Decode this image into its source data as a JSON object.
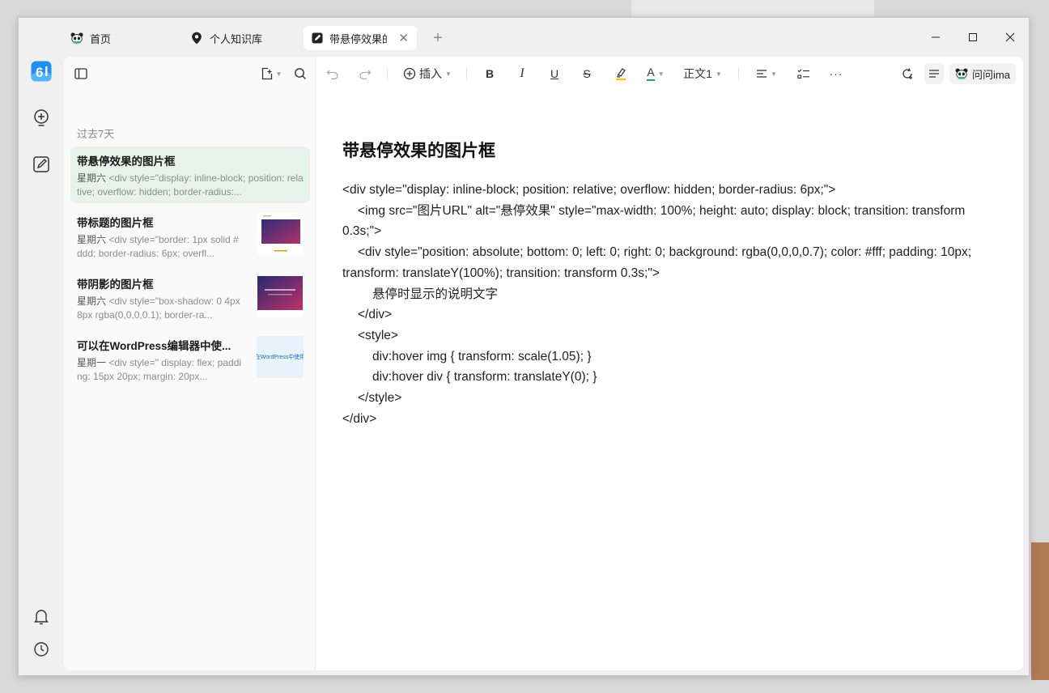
{
  "tabs": [
    {
      "label": "首页",
      "icon": "panda-icon"
    },
    {
      "label": "个人知识库",
      "icon": "location-pin-icon"
    },
    {
      "label": "带悬停效果的图",
      "icon": "note-edit-icon",
      "active": true
    }
  ],
  "rail": {
    "logo_text": "6"
  },
  "sidebar": {
    "section_label": "过去7天",
    "notes": [
      {
        "title": "带悬停效果的图片框",
        "day": "星期六",
        "preview": " <div style=\"display: inline-block; position: relative; overflow: hidden; border-radius:...",
        "thumb": "",
        "active": true
      },
      {
        "title": "带标题的图片框",
        "day": "星期六",
        "preview": " <div style=\"border: 1px solid #ddd; border-radius: 6px; overfl...",
        "thumb": "purple-card"
      },
      {
        "title": "带阴影的图片框",
        "day": "星期六",
        "preview": " <div style=\"box-shadow: 0 4px 8px rgba(0,0,0,0.1); border-ra...",
        "thumb": "purple-card-shadow"
      },
      {
        "title": "可以在WordPress编辑器中使...",
        "day": "星期一",
        "preview": " <div style=\"  display: flex;  padding: 15px 20px;  margin: 20px...",
        "thumb": "text-strip",
        "thumb_text": "在WordPress中使用"
      }
    ]
  },
  "toolbar": {
    "insert_label": "插入",
    "bold_label": "B",
    "italic_label": "I",
    "underline_label": "U",
    "strike_label": "S",
    "font_color_label": "A",
    "paragraph_label": "正文1",
    "more_label": "···",
    "ask_label": "问问ima"
  },
  "document": {
    "title": "带悬停效果的图片框",
    "lines": [
      "<div style=\"display: inline-block; position: relative; overflow: hidden; border-radius: 6px;\">",
      "<img src=\"图片URL\" alt=\"悬停效果\" style=\"max-width: 100%; height: auto; display: block; transition: transform 0.3s;\">",
      "<div style=\"position: absolute; bottom: 0; left: 0; right: 0; background: rgba(0,0,0,0.7); color: #fff; padding: 10px; transform: translateY(100%); transition: transform 0.3s;\">",
      "悬停时显示的说明文字",
      "</div>",
      "<style>",
      "div:hover img { transform: scale(1.05); }",
      "div:hover div { transform: translateY(0); }",
      "</style>",
      "</div>"
    ]
  },
  "colors": {
    "accent_green": "#e8f2ec",
    "logo_blue": "#1e8ef0",
    "highlight_yellow": "#f5c400",
    "font_color_green": "#1fa26b"
  }
}
